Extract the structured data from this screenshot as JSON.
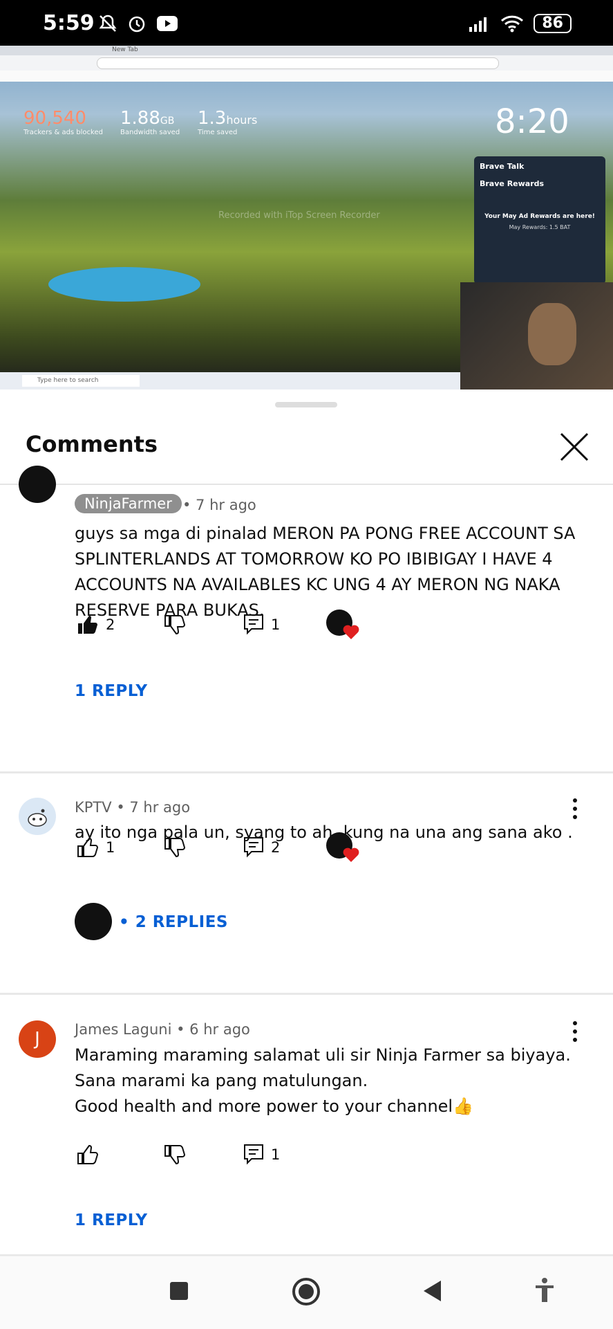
{
  "status_bar": {
    "time": "5:59",
    "battery": "86"
  },
  "video": {
    "stat1_num": "90,540",
    "stat1_label": "Trackers & ads blocked",
    "stat2_num": "1.88",
    "stat2_unit": "GB",
    "stat2_label": "Bandwidth saved",
    "stat3_num": "1.3",
    "stat3_unit": "hours",
    "stat3_label": "Time saved",
    "clock": "8:20",
    "brave_talk": "Brave Talk",
    "brave_rewards": "Brave Rewards",
    "rewards_text": "Your May Ad Rewards are here!",
    "rewards_sub": "May Rewards: 1.5 BAT",
    "watermark": "Recorded with iTop Screen Recorder",
    "taskbar_search": "Type here to search",
    "tab_active": "New Tab"
  },
  "sheet": {
    "title": "Comments"
  },
  "comments": [
    {
      "author": "NinjaFarmer",
      "time": "• 7 hr ago",
      "text": "guys sa mga di pinalad  MERON PA PONG FREE ACCOUNT SA SPLINTERLANDS AT TOMORROW KO PO IBIBIGAY I HAVE  4 ACCOUNTS NA AVAILABLES KC UNG 4 AY MERON NG NAKA RESERVE PARA BUKAS.",
      "likes": "2",
      "replies_count": "1",
      "replies_label": "1 REPLY"
    },
    {
      "author": "KPTV",
      "time": "• 7 hr ago",
      "text": "ay ito nga pala un, syang to ah, kung na una ang sana ako .",
      "likes": "1",
      "replies_count": "2",
      "replies_label": "• 2 REPLIES"
    },
    {
      "author": "James Laguni",
      "avatar_letter": "J",
      "time": "• 6 hr ago",
      "text_line1": "Maraming maraming salamat uli sir Ninja Farmer sa biyaya.",
      "text_line2": "Sana marami ka pang matulungan.",
      "text_line3": "Good health and more power to your channel👍",
      "replies_count": "1",
      "replies_label": "1 REPLY"
    }
  ],
  "colors": {
    "link": "#065fd4",
    "heart": "#e02020",
    "avatar_j": "#d84315"
  }
}
